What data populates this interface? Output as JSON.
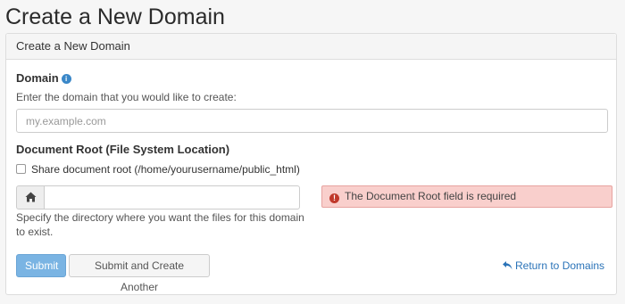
{
  "page": {
    "title": "Create a New Domain"
  },
  "panel": {
    "heading": "Create a New Domain"
  },
  "domain": {
    "label": "Domain",
    "help": "Enter the domain that you would like to create:",
    "placeholder": "my.example.com",
    "value": ""
  },
  "docroot": {
    "label": "Document Root (File System Location)",
    "share_label": "Share document root (/home/yourusername/public_html)",
    "value": "",
    "help": "Specify the directory where you want the files for this domain to exist.",
    "error": "The Document Root field is required"
  },
  "actions": {
    "submit": "Submit",
    "submit_another": "Submit and Create Another",
    "return": "Return to Domains"
  },
  "colors": {
    "primary": "#7ab4e3",
    "link": "#2a73b8",
    "error_bg": "#f9cfcc",
    "error_icon": "#c0392b"
  }
}
